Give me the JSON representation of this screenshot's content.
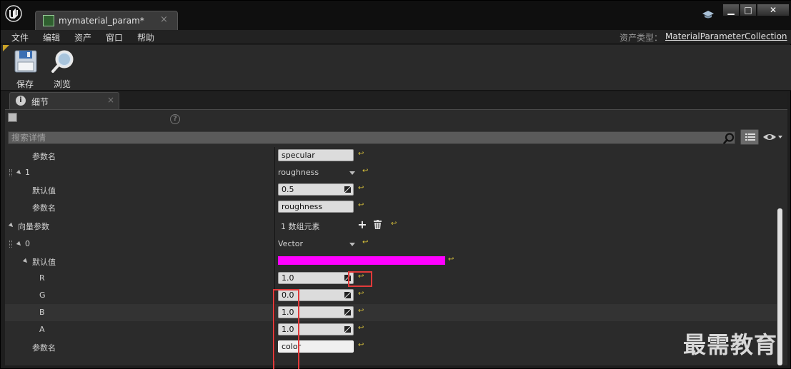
{
  "window": {
    "tab_title": "mymaterial_param*",
    "tab_close": "×",
    "min_btn": "▁",
    "max_btn": "□",
    "close_btn": "✕"
  },
  "menu": {
    "items": [
      "文件",
      "编辑",
      "资产",
      "窗口",
      "帮助"
    ],
    "asset_type_label": "资产类型：",
    "asset_type_value": "MaterialParameterCollection"
  },
  "toolbar": {
    "save_label": "保存",
    "browse_label": "浏览"
  },
  "details": {
    "tab_label": "细节",
    "tab_close": "×",
    "help": "?",
    "search_placeholder": "搜索详情"
  },
  "rows": {
    "r0": {
      "label": "参数名",
      "value": "specular"
    },
    "r1": {
      "label": "1",
      "value": "roughness"
    },
    "r2": {
      "label": "默认值",
      "value": "0.5"
    },
    "r3": {
      "label": "参数名",
      "value": "roughness"
    },
    "r4": {
      "label": "向量参数",
      "value": "1 数组元素",
      "add": "+"
    },
    "r5": {
      "label": "0",
      "value": "Vector"
    },
    "r6": {
      "label": "默认值",
      "color": "#ff00ff"
    },
    "r7": {
      "label": "R",
      "value": "1.0"
    },
    "r8": {
      "label": "G",
      "value": "0.0"
    },
    "r9": {
      "label": "B",
      "value": "1.0"
    },
    "r10": {
      "label": "A",
      "value": "1.0"
    },
    "r11": {
      "label": "参数名",
      "value": "color"
    }
  },
  "reset_glyph": "↩",
  "watermark": "最需教育",
  "colors": {
    "highlight": "#e23a3a",
    "swatch": "#ff00ff",
    "reset": "#d8c13a"
  }
}
